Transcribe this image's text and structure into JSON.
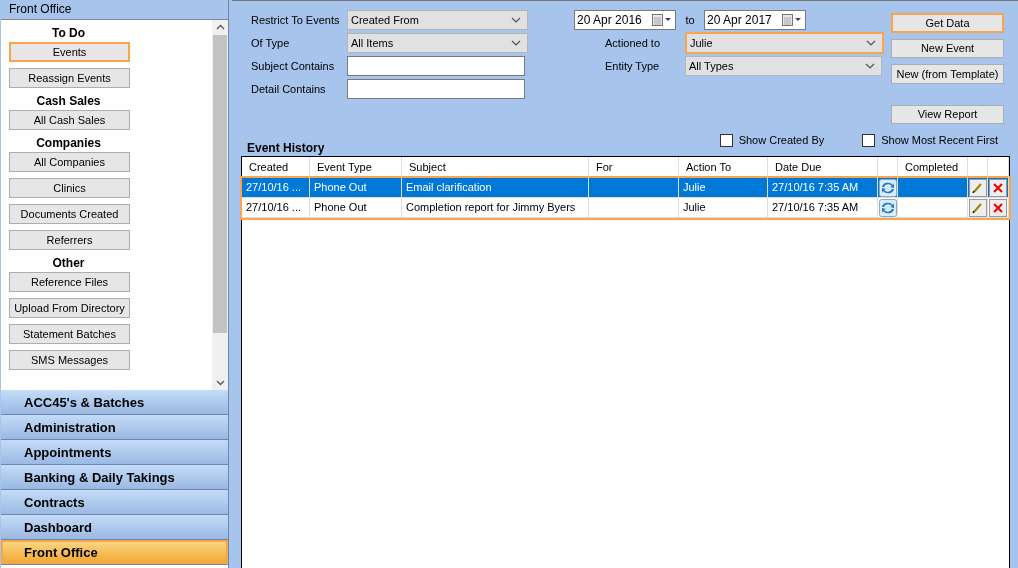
{
  "sidebar": {
    "title": "Front Office",
    "items": [
      {
        "kind": "heading",
        "label": "To Do"
      },
      {
        "kind": "button",
        "label": "Events",
        "highlighted": true
      },
      {
        "kind": "button",
        "label": "Reassign Events",
        "highlighted": false
      },
      {
        "kind": "heading",
        "label": "Cash Sales"
      },
      {
        "kind": "button",
        "label": "All Cash Sales",
        "highlighted": false
      },
      {
        "kind": "heading",
        "label": "Companies"
      },
      {
        "kind": "button",
        "label": "All Companies",
        "highlighted": false
      },
      {
        "kind": "button",
        "label": "Clinics",
        "highlighted": false
      },
      {
        "kind": "button",
        "label": "Documents Created",
        "highlighted": false
      },
      {
        "kind": "button",
        "label": "Referrers",
        "highlighted": false
      },
      {
        "kind": "heading",
        "label": "Other"
      },
      {
        "kind": "button",
        "label": "Reference Files",
        "highlighted": false
      },
      {
        "kind": "button",
        "label": "Upload From Directory",
        "highlighted": false
      },
      {
        "kind": "button",
        "label": "Statement Batches",
        "highlighted": false
      },
      {
        "kind": "button",
        "label": "SMS Messages",
        "highlighted": false
      }
    ],
    "nav": [
      {
        "label": "ACC45's & Batches",
        "selected": false
      },
      {
        "label": "Administration",
        "selected": false
      },
      {
        "label": "Appointments",
        "selected": false
      },
      {
        "label": "Banking & Daily Takings",
        "selected": false
      },
      {
        "label": "Contracts",
        "selected": false
      },
      {
        "label": "Dashboard",
        "selected": false
      },
      {
        "label": "Front Office",
        "selected": true
      }
    ]
  },
  "filters": {
    "left": [
      {
        "kind": "dropdown",
        "label": "Restrict To Events",
        "value": "Created From"
      },
      {
        "kind": "dropdown",
        "label": "Of Type",
        "value": "All Items"
      },
      {
        "kind": "text",
        "label": "Subject Contains"
      },
      {
        "kind": "text",
        "label": "Detail Contains"
      }
    ],
    "date_from": "20 Apr 2016",
    "to_label": "to",
    "date_to": "20 Apr 2017",
    "right": [
      {
        "kind": "dropdown",
        "label": "Actioned to",
        "value": "Julie",
        "highlighted": true
      },
      {
        "kind": "dropdown",
        "label": "Entity Type",
        "value": "All Types",
        "highlighted": false
      }
    ]
  },
  "buttons": [
    {
      "label": "Get Data",
      "highlighted": true
    },
    {
      "label": "New Event",
      "highlighted": false
    },
    {
      "label": "New (from Template)",
      "highlighted": false
    },
    {
      "label": "View Report",
      "highlighted": false
    }
  ],
  "checkboxes": [
    {
      "label": "Show Created By",
      "checked": false
    },
    {
      "label": "Show Most Recent First",
      "checked": false
    }
  ],
  "table": {
    "title": "Event History",
    "highlighted": true,
    "columns": [
      "Created",
      "Event Type",
      "Subject",
      "For",
      "Action To",
      "Date Due",
      "",
      "Completed",
      "",
      ""
    ],
    "rows": [
      {
        "selected": true,
        "cells": [
          "27/10/16 ...",
          "Phone Out",
          "Email clarification",
          "",
          "Julie",
          "27/10/16 7:35 AM"
        ]
      },
      {
        "selected": false,
        "cells": [
          "27/10/16 ...",
          "Phone Out",
          "Completion report for Jimmy Byers",
          "",
          "Julie",
          "27/10/16 7:35 AM"
        ]
      }
    ]
  }
}
